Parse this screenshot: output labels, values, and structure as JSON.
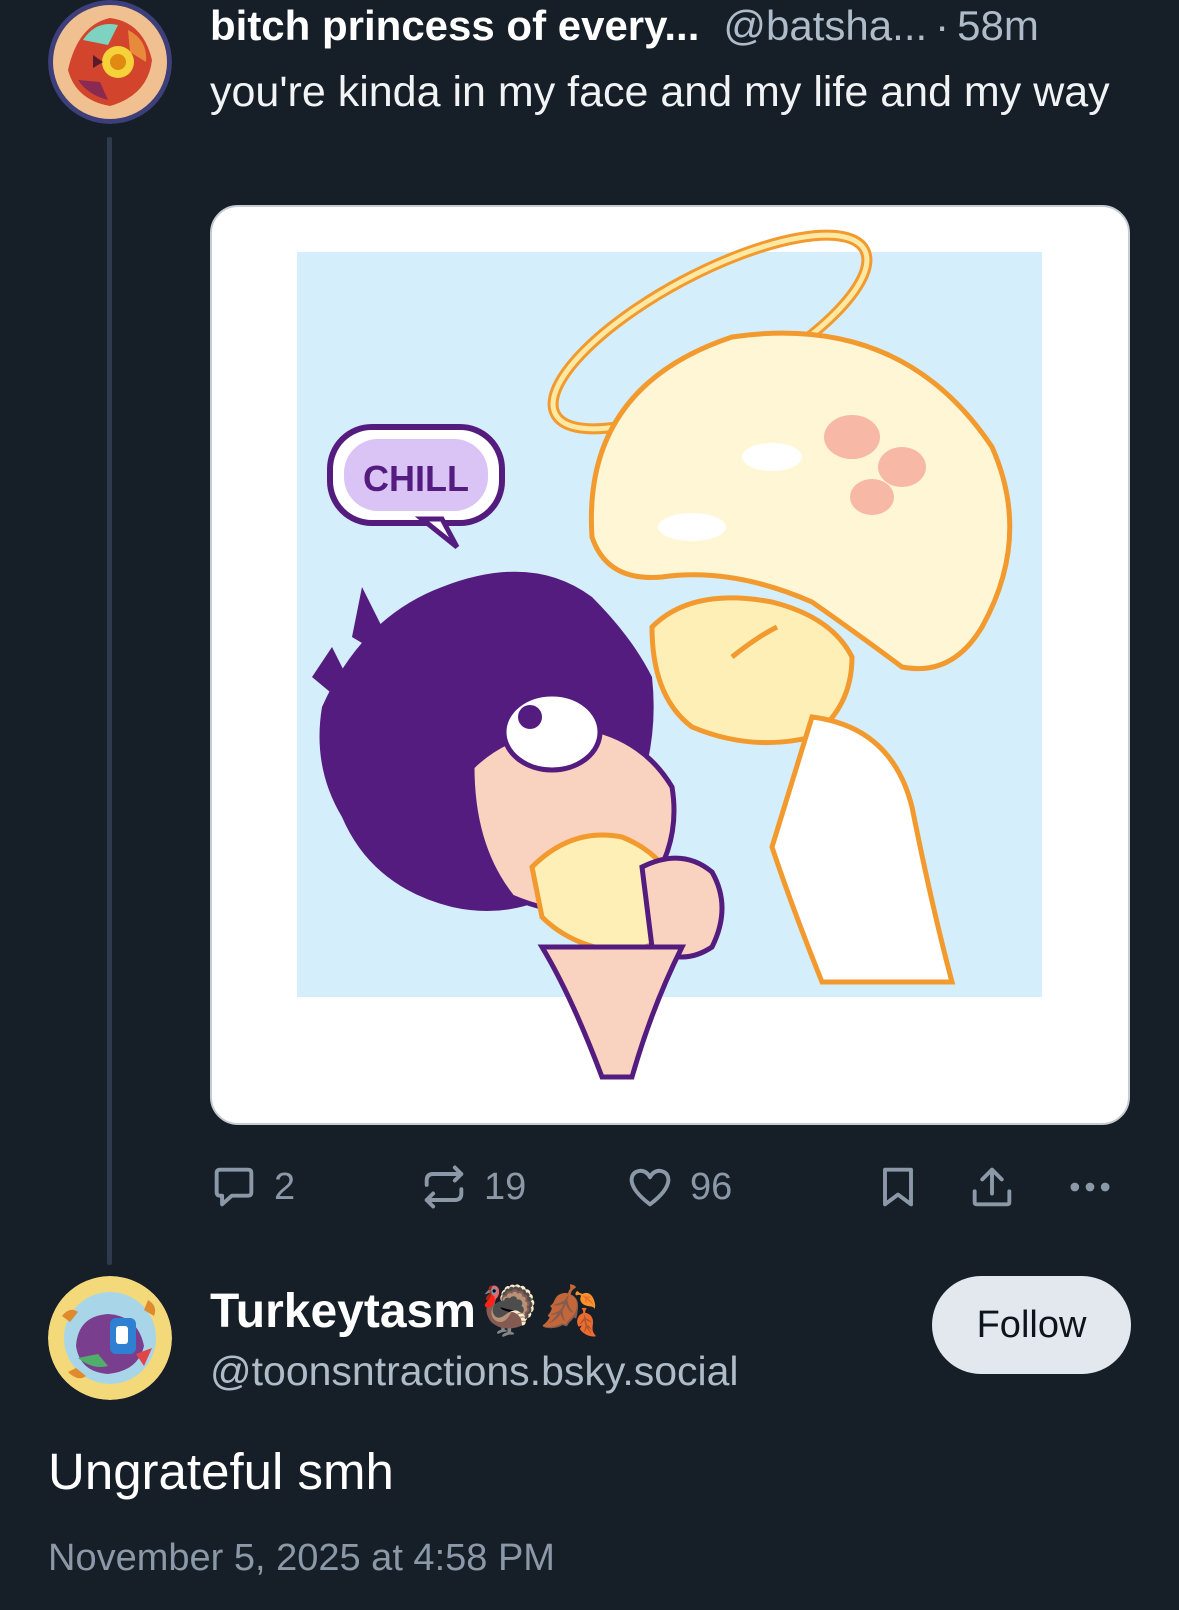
{
  "parent_post": {
    "author_name": "bitch princess of every...",
    "author_handle": "@batsha...",
    "separator": "·",
    "time_ago": "58m",
    "text": "you're kinda in my face and my life and my way",
    "image": {
      "speech_bubble": "CHILL"
    },
    "actions": {
      "replies": "2",
      "reposts": "19",
      "likes": "96"
    }
  },
  "reply_post": {
    "author_name": "Turkeytasm",
    "author_emoji": "🦃🍂",
    "author_handle": "@toonsntractions.bsky.social",
    "follow_label": "Follow",
    "text": "Ungrateful smh",
    "timestamp": "November 5, 2025 at 4:58 PM"
  },
  "icons": [
    "reply-icon",
    "repost-icon",
    "like-icon",
    "bookmark-icon",
    "share-icon",
    "more-icon"
  ],
  "colors": {
    "background": "#161e27",
    "muted_text": "#aebbc9",
    "thread_line": "#2e3b4c",
    "follow_button": "#e3e8ef"
  }
}
